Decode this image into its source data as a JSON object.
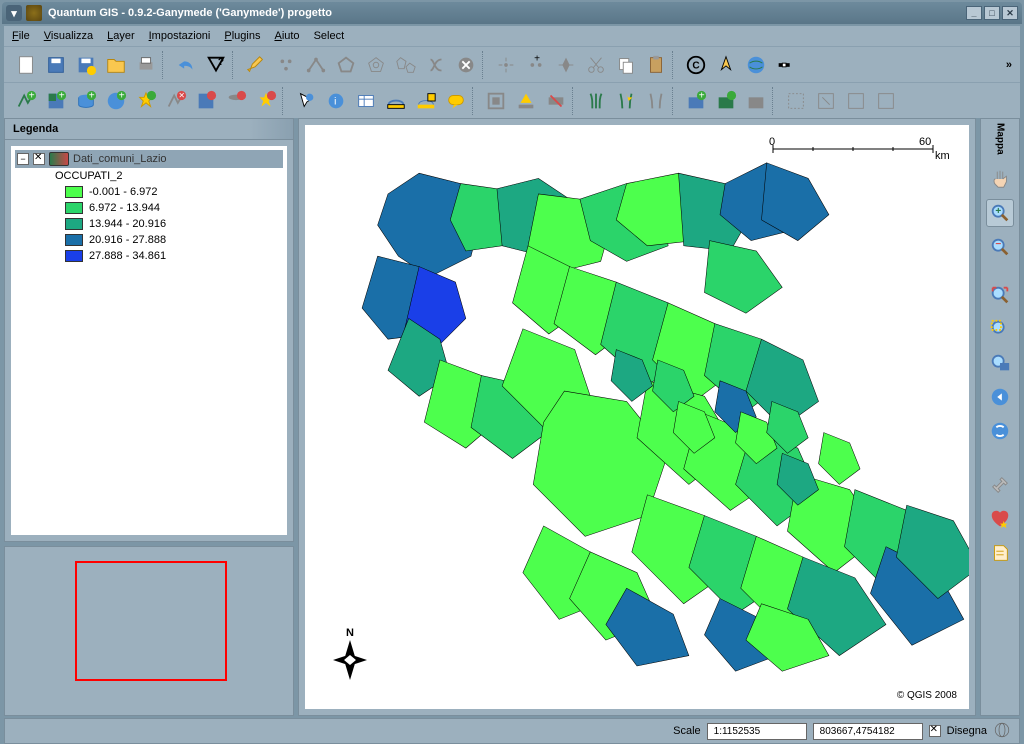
{
  "window": {
    "title": "Quantum GIS - 0.9.2-Ganymede ('Ganymede')  progetto"
  },
  "menu": {
    "file": "File",
    "visualizza": "Visualizza",
    "layer": "Layer",
    "impostazioni": "Impostazioni",
    "plugins": "Plugins",
    "aiuto": "Aiuto",
    "select": "Select"
  },
  "legend": {
    "title": "Legenda",
    "layer_name": "Dati_comuni_Lazio",
    "attribute": "OCCUPATI_2",
    "classes": [
      {
        "label": "-0.001 - 6.972",
        "color": "#4DFF4D"
      },
      {
        "label": "6.972 - 13.944",
        "color": "#2BD46A"
      },
      {
        "label": "13.944 - 20.916",
        "color": "#1DA882"
      },
      {
        "label": "20.916 - 27.888",
        "color": "#1A6FA8"
      },
      {
        "label": "27.888 - 34.861",
        "color": "#1A3FE8"
      }
    ]
  },
  "map": {
    "right_label": "Mappa",
    "scale_values": {
      "zero": "0",
      "max": "60",
      "unit": "km"
    },
    "north": "N",
    "copyright": "© QGIS 2008"
  },
  "statusbar": {
    "scale_label": "Scale",
    "scale_value": "1:1152535",
    "coords": "803667,4754182",
    "disegna": "Disegna"
  },
  "icons": {
    "minimize": "_",
    "maximize": "□",
    "close": "✕",
    "more": "»"
  }
}
